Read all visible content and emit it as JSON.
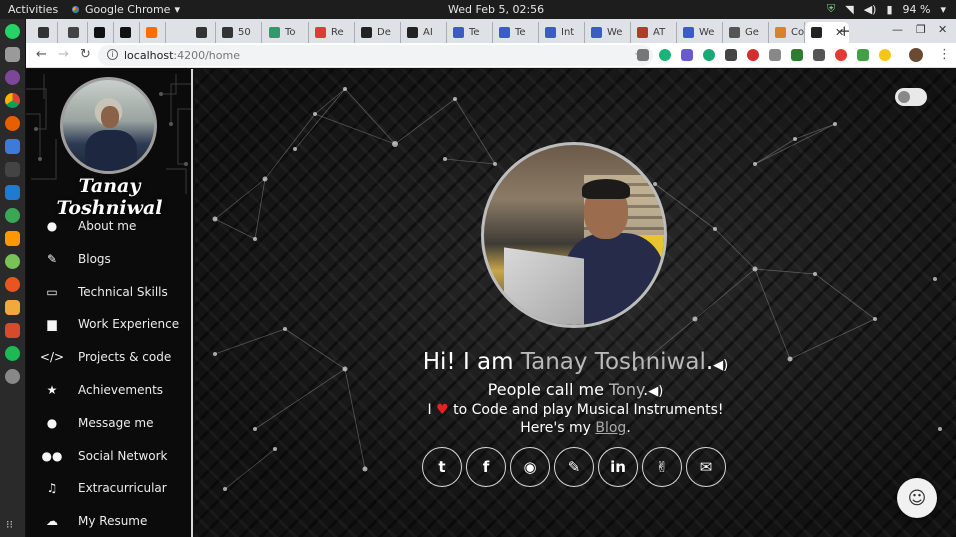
{
  "os_bar": {
    "activities": "Activities",
    "app_name": "Google Chrome",
    "clock": "Wed Feb  5, 02:56",
    "battery": "94 %"
  },
  "tabs": [
    {
      "label": "",
      "color": "#333333"
    },
    {
      "label": "",
      "color": "#444444"
    },
    {
      "label": "",
      "color": "#111111"
    },
    {
      "label": "",
      "color": "#111111"
    },
    {
      "label": "",
      "color": "#ff6d00"
    },
    {
      "label": "",
      "color": "#333333"
    },
    {
      "label": "50",
      "color": "#333333"
    },
    {
      "label": "To",
      "color": "#2f9a6a"
    },
    {
      "label": "Re",
      "color": "#e53935"
    },
    {
      "label": "De",
      "color": "#222222"
    },
    {
      "label": "AI",
      "color": "#222222"
    },
    {
      "label": "Te",
      "color": "#3b5cc4"
    },
    {
      "label": "Te",
      "color": "#3b5cc4"
    },
    {
      "label": "Int",
      "color": "#3b5cc4"
    },
    {
      "label": "We",
      "color": "#3b5cc4"
    },
    {
      "label": "AT",
      "color": "#b23b2a"
    },
    {
      "label": "We",
      "color": "#3b5cc4"
    },
    {
      "label": "Ge",
      "color": "#555555"
    },
    {
      "label": "Co",
      "color": "#d9822b"
    },
    {
      "label": "",
      "color": "#222222",
      "active": true
    }
  ],
  "address_bar": {
    "host": "localhost",
    "path": ":4200/home"
  },
  "profile": {
    "name": "Tanay Toshniwal"
  },
  "nav": [
    {
      "icon": "user-icon",
      "glyph": "●",
      "label": "About me"
    },
    {
      "icon": "pencil-icon",
      "glyph": "✎",
      "label": "Blogs"
    },
    {
      "icon": "laptop-icon",
      "glyph": "▭",
      "label": "Technical Skills"
    },
    {
      "icon": "briefcase-icon",
      "glyph": "▆",
      "label": "Work Experience"
    },
    {
      "icon": "code-icon",
      "glyph": "</>",
      "label": "Projects & code"
    },
    {
      "icon": "star-icon",
      "glyph": "★",
      "label": "Achievements"
    },
    {
      "icon": "comments-icon",
      "glyph": "●",
      "label": "Message me"
    },
    {
      "icon": "users-icon",
      "glyph": "●●",
      "label": "Social Network"
    },
    {
      "icon": "music-icon",
      "glyph": "♫",
      "label": "Extracurricular"
    },
    {
      "icon": "cloud-download-icon",
      "glyph": "☁",
      "label": "My Resume"
    }
  ],
  "hero": {
    "greeting_prefix": "Hi! I am ",
    "greeting_name": "Tanay Toshniwal",
    "greeting_suffix": ".",
    "nickname_prefix": "People call me ",
    "nickname": "Tony",
    "nickname_suffix": ".",
    "tagline_prefix": "I ",
    "tagline_suffix": " to Code and play Musical Instruments!",
    "blog_prefix": "Here's my ",
    "blog_link": "Blog",
    "blog_suffix": "."
  },
  "socials": [
    {
      "icon": "twitter-icon",
      "glyph": "t"
    },
    {
      "icon": "facebook-icon",
      "glyph": "f"
    },
    {
      "icon": "github-icon",
      "glyph": "◉"
    },
    {
      "icon": "pencil-icon",
      "glyph": "✎"
    },
    {
      "icon": "linkedin-icon",
      "glyph": "in"
    },
    {
      "icon": "peace-hand-icon",
      "glyph": "✌"
    },
    {
      "icon": "envelope-icon",
      "glyph": "✉"
    }
  ],
  "colors": {
    "accent_grey": "#b9b9b9",
    "heart": "#e52222",
    "sidebar_bg": "#0b0b0b"
  }
}
